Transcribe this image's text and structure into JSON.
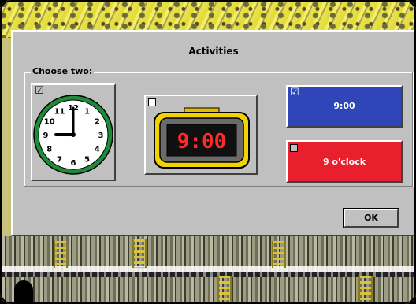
{
  "dialog": {
    "title": "Activities",
    "group_label": "Choose two:",
    "ok_label": "OK"
  },
  "options": {
    "analog_clock": {
      "checked_mark": "☑",
      "checked": true
    },
    "digital_clock": {
      "display": "9:00",
      "checked": false
    },
    "blue_button": {
      "label": "9:00",
      "checked_mark": "☑",
      "checked": true,
      "color": "#2e46b8"
    },
    "red_button": {
      "label": "9 o'clock",
      "checked": false,
      "color": "#e8202e"
    }
  },
  "clock_face": {
    "numbers": [
      "12",
      "1",
      "2",
      "3",
      "4",
      "5",
      "6",
      "7",
      "8",
      "9",
      "10",
      "11"
    ],
    "hour": 9,
    "minute": 0,
    "rim_color": "#1e8a3a"
  },
  "digital_color": "#ff2a2a"
}
